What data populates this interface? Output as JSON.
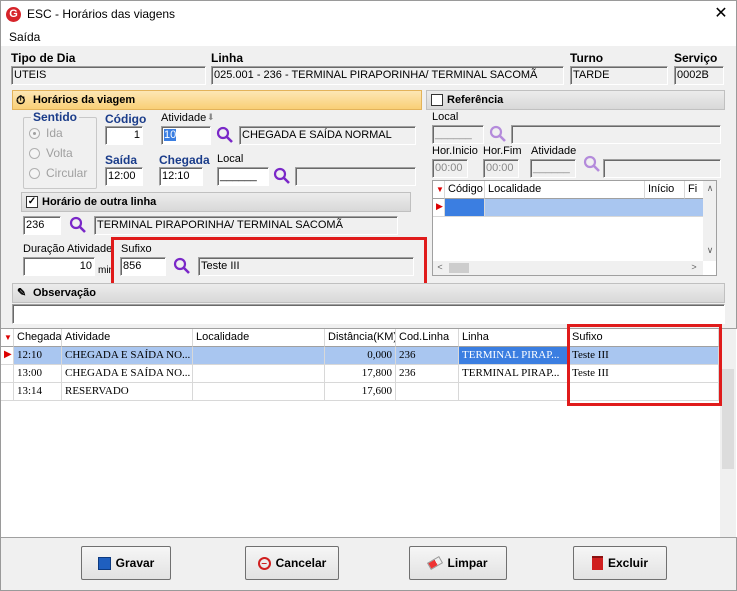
{
  "window": {
    "title": "ESC - Horários das viagens",
    "menu": "Saída"
  },
  "header": {
    "tipo_label": "Tipo de Dia",
    "tipo_value": "UTEIS",
    "linha_label": "Linha",
    "linha_value": "025.001 - 236 - TERMINAL PIRAPORINHA/ TERMINAL SACOMÃ",
    "turno_label": "Turno",
    "turno_value": "TARDE",
    "servico_label": "Serviço",
    "servico_value": "0002B"
  },
  "horarios": {
    "title": "Horários da viagem",
    "sentido_label": "Sentido",
    "sentido_options": [
      "Ida",
      "Volta",
      "Circular"
    ],
    "codigo_label": "Código",
    "codigo_value": "1",
    "atividade_label": "Atividade",
    "atividade_code": "10",
    "atividade_desc": "CHEGADA E SAÍDA NORMAL",
    "saida_label": "Saída",
    "saida_value": "12:00",
    "chegada_label": "Chegada",
    "chegada_value": "12:10",
    "local_label": "Local",
    "local_value": "______",
    "local_desc": ""
  },
  "outra_linha": {
    "title": "Horário de outra linha",
    "checked": true,
    "linha_code": "236",
    "linha_desc": "TERMINAL PIRAPORINHA/ TERMINAL SACOMÃ",
    "duracao_label": "Duração Atividade",
    "duracao_value": "10",
    "duracao_unit": "min",
    "sufixo_label": "Sufixo",
    "sufixo_code": "856",
    "sufixo_desc": "Teste III"
  },
  "referencia": {
    "title": "Referência",
    "checked": false,
    "local_label": "Local",
    "local_value": "______",
    "hor_inicio_label": "Hor.Inicio",
    "hor_inicio_value": "00:00",
    "hor_fim_label": "Hor.Fim",
    "hor_fim_value": "00:00",
    "atividade_label": "Atividade",
    "atividade_value": "______",
    "grid_headers": [
      "Código",
      "Localidade",
      "Início",
      "Fi"
    ]
  },
  "observacao": {
    "title": "Observação",
    "value": ""
  },
  "table": {
    "headers": [
      "Chegada",
      "Atividade",
      "Localidade",
      "Distância(KM)",
      "Cod.Linha",
      "Linha",
      "Sufixo"
    ],
    "rows": [
      [
        "12:10",
        "CHEGADA E SAÍDA NO...",
        "",
        "0,000",
        "236",
        "TERMINAL PIRAP...",
        "Teste III"
      ],
      [
        "13:00",
        "CHEGADA E SAÍDA NO...",
        "",
        "17,800",
        "236",
        "TERMINAL PIRAP...",
        "Teste III"
      ],
      [
        "13:14",
        "RESERVADO",
        "",
        "17,600",
        "",
        "",
        ""
      ]
    ]
  },
  "buttons": {
    "gravar": "Gravar",
    "cancelar": "Cancelar",
    "limpar": "Limpar",
    "excluir": "Excluir"
  },
  "colors": {
    "accent_red": "#e01b1b",
    "selection": "#a9c6f0",
    "search_icon": "#7a28c8",
    "panel_orange": "#f9cf76"
  }
}
